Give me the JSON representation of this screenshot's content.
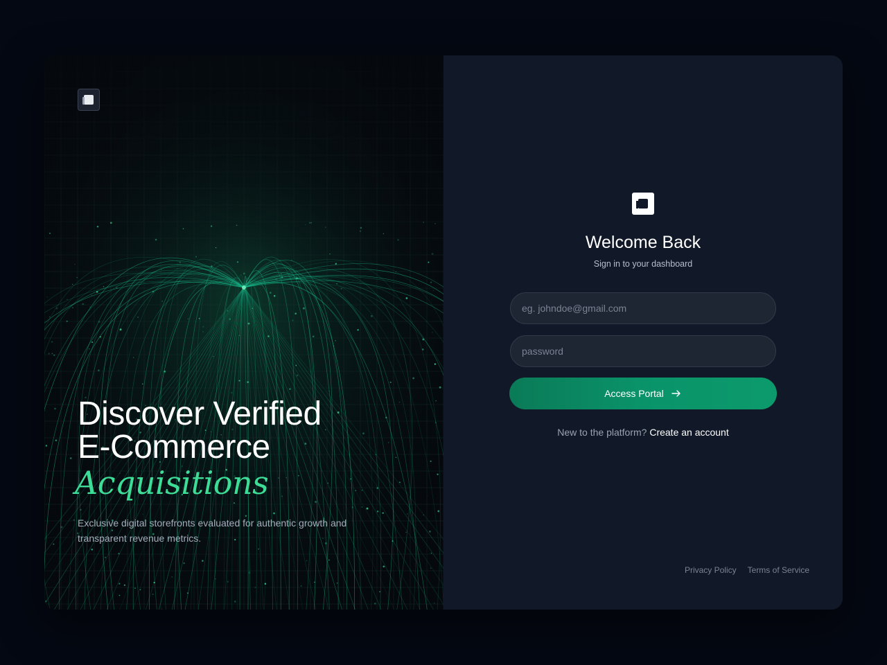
{
  "hero": {
    "title_line1": "Discover Verified",
    "title_line2": "E-Commerce",
    "title_accent": "Acquisitions",
    "description": "Exclusive digital storefronts evaluated for authentic growth and transparent revenue metrics."
  },
  "login": {
    "title": "Welcome Back",
    "subtitle": "Sign in to your dashboard",
    "email_placeholder": "eg. johndoe@gmail.com",
    "email_value": "",
    "password_placeholder": "password",
    "password_value": "",
    "submit_label": "Access Portal",
    "signup_prompt": "New to the platform?",
    "signup_link": "Create an account"
  },
  "footer": {
    "privacy": "Privacy Policy",
    "terms": "Terms of Service"
  },
  "icons": {
    "brand": "logo-icon",
    "submit": "arrow-right-icon"
  },
  "colors": {
    "page_background": "#040812",
    "panel_left": "#05090e",
    "panel_right": "#111827",
    "accent": "#3ddc97",
    "button": "#0a9369"
  }
}
